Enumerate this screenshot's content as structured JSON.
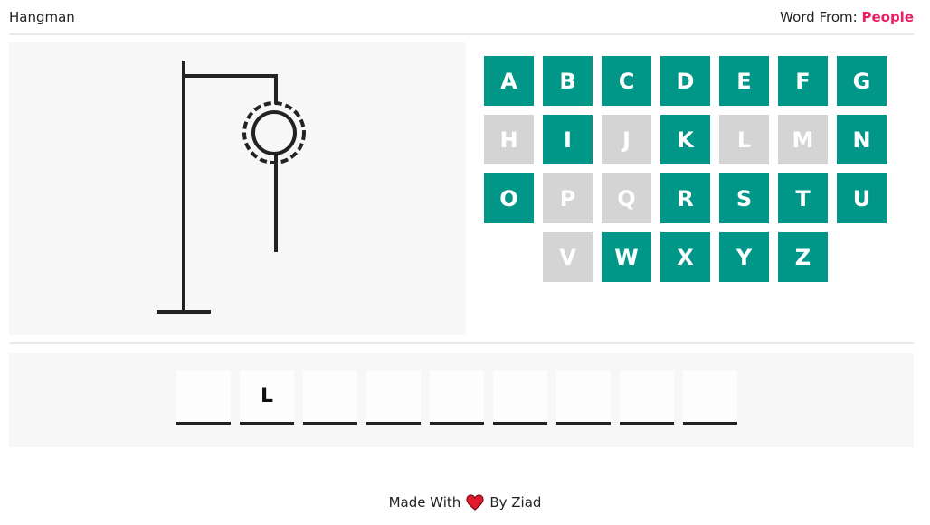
{
  "header": {
    "title": "Hangman",
    "category_label": "Word From:",
    "category_value": "People"
  },
  "colors": {
    "letter_available": "#009688",
    "letter_used": "#d4d4d4",
    "category_accent": "#e91e63",
    "heart": "#e21b2c"
  },
  "hangman": {
    "wrong_guesses_drawn": [
      "head",
      "body"
    ]
  },
  "letters": [
    {
      "char": "A",
      "used": false
    },
    {
      "char": "B",
      "used": false
    },
    {
      "char": "C",
      "used": false
    },
    {
      "char": "D",
      "used": false
    },
    {
      "char": "E",
      "used": false
    },
    {
      "char": "F",
      "used": false
    },
    {
      "char": "G",
      "used": false
    },
    {
      "char": "H",
      "used": true
    },
    {
      "char": "I",
      "used": false
    },
    {
      "char": "J",
      "used": true
    },
    {
      "char": "K",
      "used": false
    },
    {
      "char": "L",
      "used": true
    },
    {
      "char": "M",
      "used": true
    },
    {
      "char": "N",
      "used": false
    },
    {
      "char": "O",
      "used": false
    },
    {
      "char": "P",
      "used": true
    },
    {
      "char": "Q",
      "used": true
    },
    {
      "char": "R",
      "used": false
    },
    {
      "char": "S",
      "used": false
    },
    {
      "char": "T",
      "used": false
    },
    {
      "char": "U",
      "used": false
    },
    {
      "char": "V",
      "used": true
    },
    {
      "char": "W",
      "used": false
    },
    {
      "char": "X",
      "used": false
    },
    {
      "char": "Y",
      "used": false
    },
    {
      "char": "Z",
      "used": false
    }
  ],
  "word_slots": [
    "",
    "L",
    "",
    "",
    "",
    "",
    "",
    "",
    ""
  ],
  "footer": {
    "made_with": "Made With",
    "heart_icon": "heart-icon",
    "by": "By Ziad"
  }
}
